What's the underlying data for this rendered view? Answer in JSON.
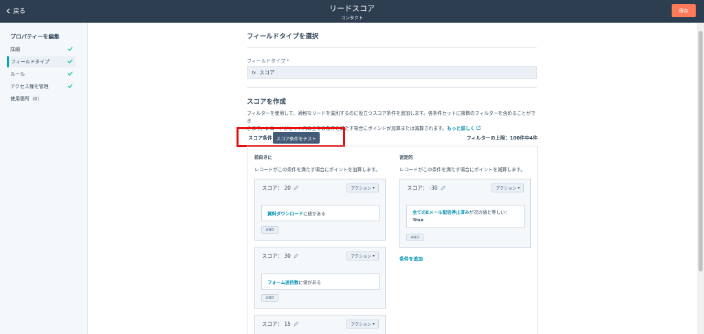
{
  "header": {
    "back_label": "戻る",
    "title": "リードスコア",
    "subtitle": "コンタクト",
    "save_label": "保存"
  },
  "sidebar": {
    "title": "プロパティーを編集",
    "items": [
      {
        "label": "詳細",
        "checked": true
      },
      {
        "label": "フィールドタイプ",
        "checked": true,
        "active": true
      },
      {
        "label": "ルール",
        "checked": true
      },
      {
        "label": "アクセス権を管理",
        "checked": true
      },
      {
        "label": "使用箇所（0）",
        "checked": false
      }
    ]
  },
  "field_type_section": {
    "heading": "フィールドタイプを選択",
    "field_label": "フィールドタイプ *",
    "field_icon": "fx-icon",
    "field_value": "スコア"
  },
  "score_section": {
    "heading": "スコアを作成",
    "description_1": "フィルターを使用して、適格なリードを識別するのに役立つスコア条件を追加します。各条件セットに複数のフィルターを含めることができ",
    "description_2": "きます。レコードがセット内の全ての条件を満たす場合にポイントが加算または減算されます。",
    "learn_more": "もっと詳しく",
    "conditions_label": "スコア条件",
    "test_button": "スコア条件をテスト",
    "filter_limit": "フィルターの上限：100件中4件"
  },
  "positive": {
    "heading": "前向きに",
    "description": "レコードがこの条件を満たす場合にポイントを加算します。",
    "cards": [
      {
        "score": "スコア：  20",
        "action": "アクション",
        "property": "資料ダウンロード",
        "condition": "に値がある",
        "and": "AND"
      },
      {
        "score": "スコア：  30",
        "action": "アクション",
        "property": "フォーム送信数",
        "condition": "に値がある",
        "and": "AND"
      },
      {
        "score": "スコア：  15",
        "action": "アクション"
      }
    ]
  },
  "negative": {
    "heading": "否定的",
    "description": "レコードがこの条件を満たす場合にポイントを減算します。",
    "cards": [
      {
        "score": "スコア：  -30",
        "action": "アクション",
        "property": "全てのEメール配信停止済み",
        "condition": "が次の値と等しい：",
        "value": "True",
        "and": "AND"
      }
    ],
    "add_condition": "条件を追加"
  },
  "colors": {
    "header_bg": "#2d3e50",
    "accent": "#ff7a59",
    "link": "#0091ae",
    "highlight": "#e8100f"
  }
}
